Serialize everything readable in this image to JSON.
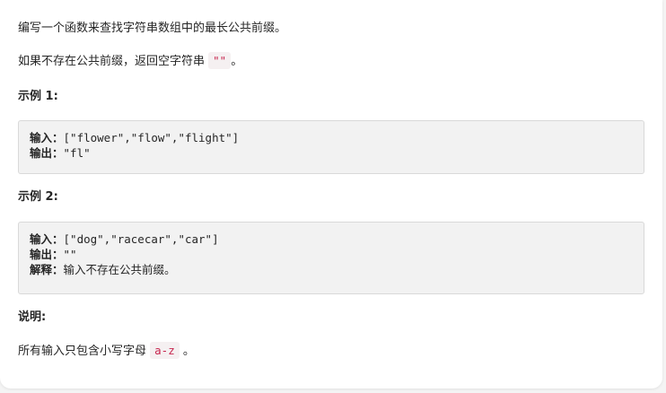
{
  "intro": "编写一个函数来查找字符串数组中的最长公共前缀。",
  "no_prefix": {
    "before": "如果不存在公共前缀，返回空字符串 ",
    "code": "\"\"",
    "after": "。"
  },
  "example1": {
    "title": "示例 1:",
    "input_label": "输入：",
    "input_value": "[\"flower\",\"flow\",\"flight\"]",
    "output_label": "输出：",
    "output_value": "\"fl\""
  },
  "example2": {
    "title": "示例 2:",
    "input_label": "输入：",
    "input_value": "[\"dog\",\"racecar\",\"car\"]",
    "output_label": "输出：",
    "output_value": "\"\"",
    "explain_label": "解释：",
    "explain_value": "输入不存在公共前缀。"
  },
  "note": {
    "title": "说明:",
    "before": "所有输入只包含小写字母 ",
    "code": "a-z",
    "after": " 。"
  }
}
